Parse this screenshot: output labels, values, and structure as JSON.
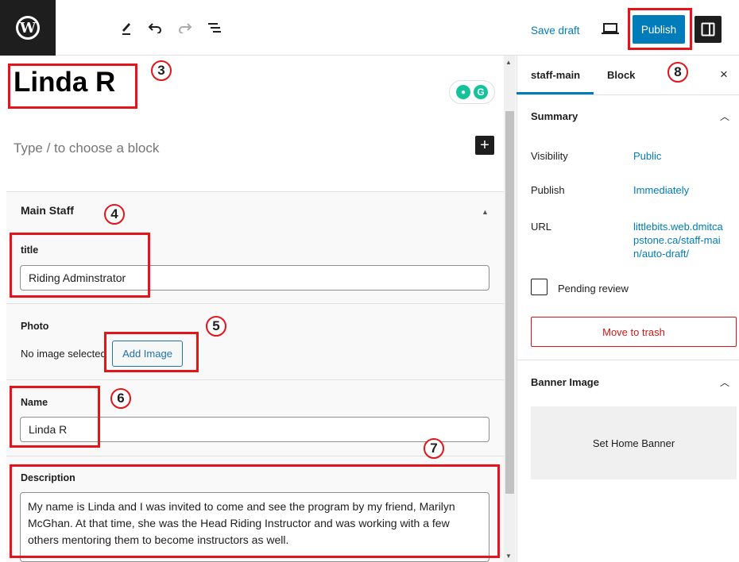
{
  "toolbar": {
    "logo": "W",
    "add_icon": "+",
    "tools_icon": "pencil-icon",
    "undo_icon": "↶",
    "redo_icon": "↷",
    "list_view_icon": "list-view-icon",
    "save_draft": "Save draft",
    "publish": "Publish",
    "preview_icon": "desktop-icon",
    "settings_icon": "sidebar-icon"
  },
  "editor": {
    "post_title": "Linda R",
    "block_placeholder": "Type / to choose a block",
    "inserter": "+",
    "meta_box": {
      "header": "Main Staff",
      "fields": {
        "title": {
          "label": "title",
          "value": "Riding Adminstrator"
        },
        "photo": {
          "label": "Photo",
          "status": "No image selected",
          "button": "Add Image"
        },
        "name": {
          "label": "Name",
          "value": "Linda R"
        },
        "description": {
          "label": "Description",
          "value": "My name is Linda and I was invited to come and see the program by my friend, Marilyn McGhan. At that time, she was the Head Riding Instructor and was working with a few others mentoring them to become instructors as well."
        }
      }
    }
  },
  "annotations": [
    "3",
    "4",
    "5",
    "6",
    "7",
    "8"
  ],
  "sidebar": {
    "tabs": [
      "staff-main",
      "Block"
    ],
    "active_tab": "staff-main",
    "close": "×",
    "summary": {
      "title": "Summary",
      "rows": [
        {
          "label": "Visibility",
          "value": "Public"
        },
        {
          "label": "Publish",
          "value": "Immediately"
        },
        {
          "label": "URL",
          "value": "littlebits.web.dmitcapstone.ca/staff-main/auto-draft/"
        }
      ],
      "pending_review": "Pending review",
      "move_to_trash": "Move to trash"
    },
    "banner": {
      "title": "Banner Image",
      "button": "Set Home Banner"
    }
  },
  "colors": {
    "accent": "#007cba",
    "annotation": "#e3151a",
    "danger": "#cc1818"
  }
}
